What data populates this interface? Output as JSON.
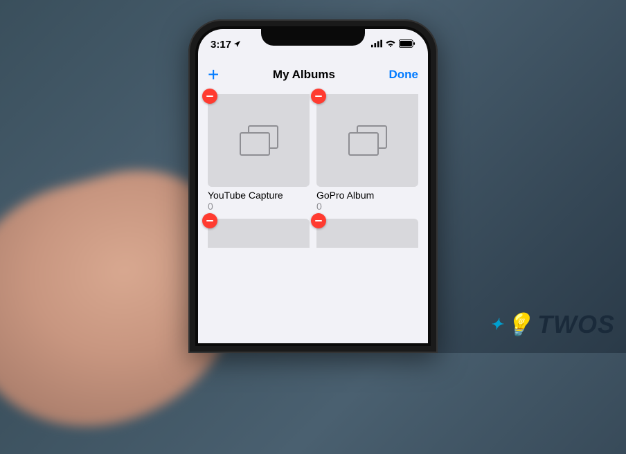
{
  "status": {
    "time": "3:17",
    "location_enabled": true
  },
  "nav": {
    "title": "My Albums",
    "done_label": "Done",
    "add_label": "+"
  },
  "albums": [
    {
      "name": "YouTube Capture",
      "count": "0"
    },
    {
      "name": "GoPro Album",
      "count": "0"
    },
    {
      "name": "",
      "count": ""
    },
    {
      "name": "",
      "count": ""
    }
  ],
  "watermark": {
    "text": "TWOS"
  }
}
